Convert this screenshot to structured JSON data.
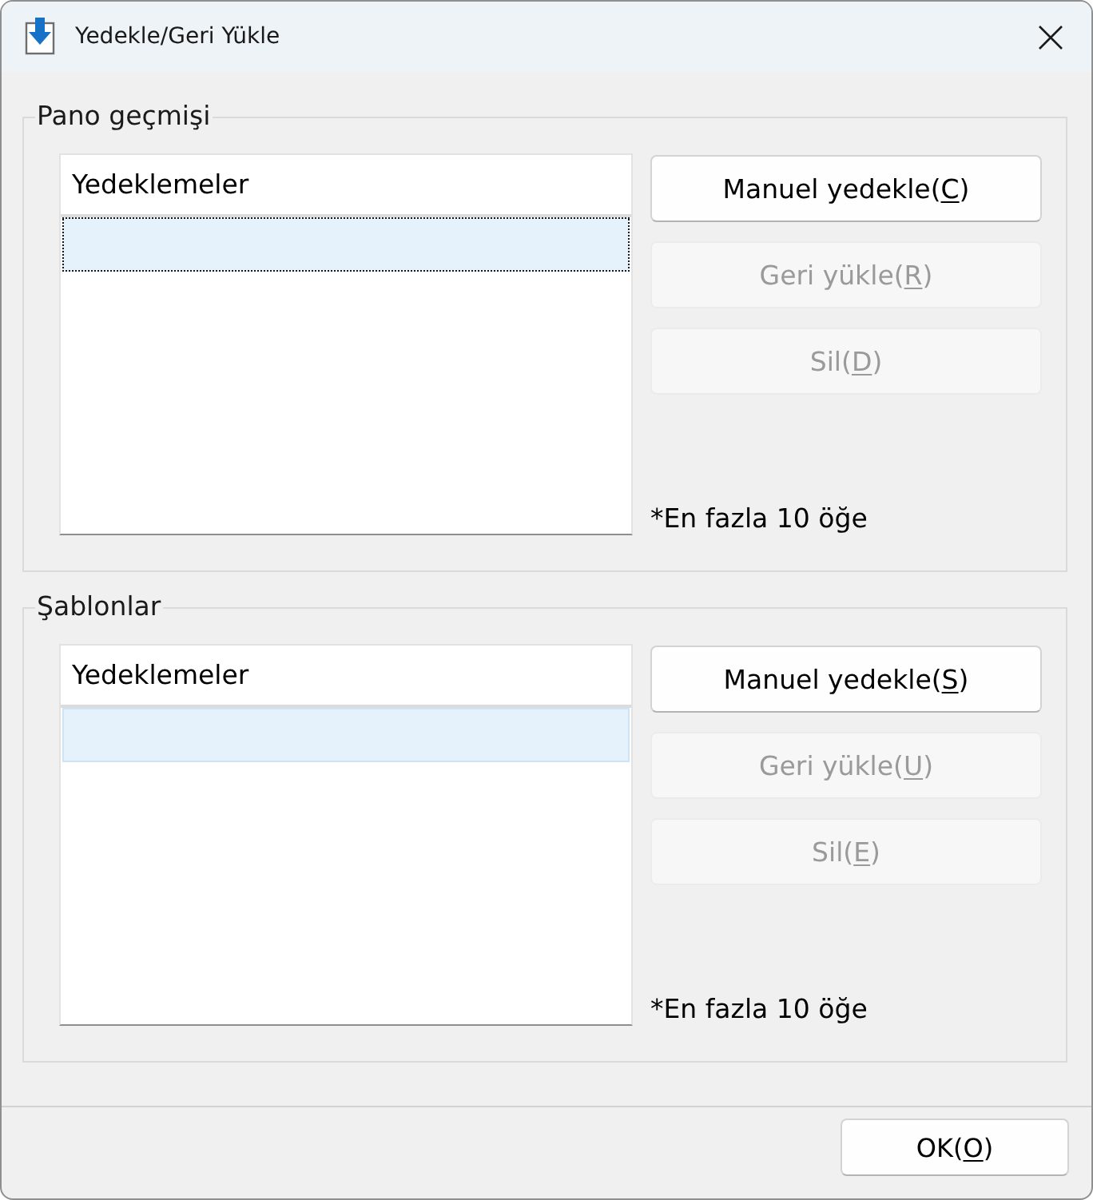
{
  "window": {
    "title": "Yedekle/Geri Yükle"
  },
  "groups": [
    {
      "title": "Pano geçmişi",
      "list": {
        "column": "Yedeklemeler",
        "rows": [
          {
            "selected": true,
            "focused": true
          }
        ]
      },
      "buttons": [
        {
          "text": "Manuel yedekle(",
          "access_key": "C",
          "text_after": ")",
          "disabled": false
        },
        {
          "text": "Geri yükle(",
          "access_key": "R",
          "text_after": ")",
          "disabled": true
        },
        {
          "text": "Sil(",
          "access_key": "D",
          "text_after": ")",
          "disabled": true
        }
      ],
      "note": "*En fazla 10 öğe"
    },
    {
      "title": "Şablonlar",
      "list": {
        "column": "Yedeklemeler",
        "rows": [
          {
            "selected": true,
            "focused": false
          }
        ]
      },
      "buttons": [
        {
          "text": "Manuel yedekle(",
          "access_key": "S",
          "text_after": ")",
          "disabled": false
        },
        {
          "text": "Geri yükle(",
          "access_key": "U",
          "text_after": ")",
          "disabled": true
        },
        {
          "text": "Sil(",
          "access_key": "E",
          "text_after": ")",
          "disabled": true
        }
      ],
      "note": "*En fazla 10 öğe"
    }
  ],
  "footer": {
    "buttons": [
      {
        "text": "OK(",
        "access_key": "O",
        "text_after": ")",
        "disabled": false
      }
    ]
  }
}
